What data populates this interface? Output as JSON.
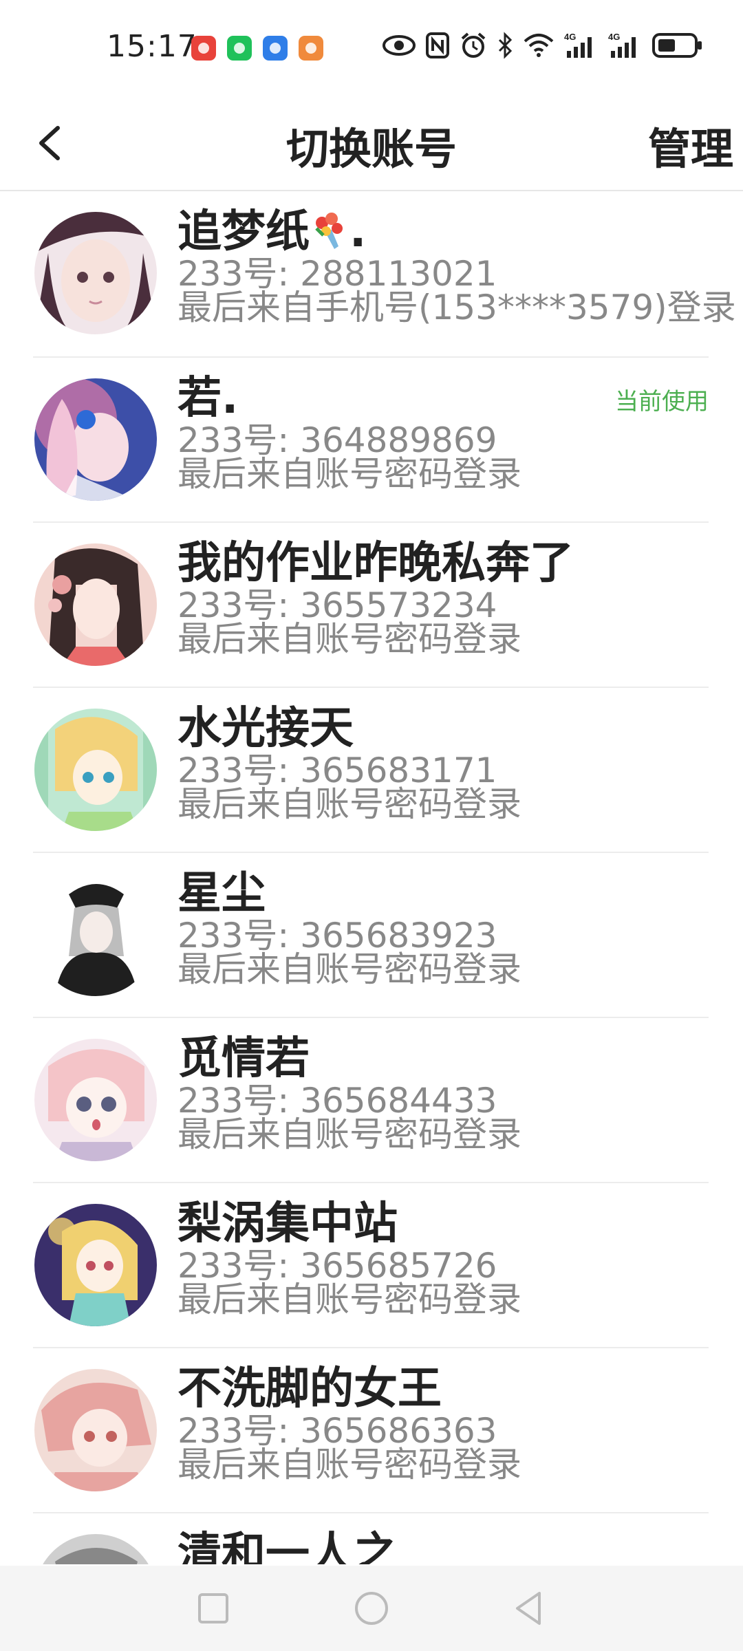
{
  "status_bar": {
    "time": "15:17",
    "icons": [
      "eye-icon",
      "nfc-icon",
      "alarm-icon",
      "bluetooth-icon",
      "wifi-icon",
      "4g-signal-icon",
      "4g-signal-icon",
      "battery-icon"
    ],
    "signal_label_1": "4G",
    "signal_label_2": "4G"
  },
  "header": {
    "title": "切换账号",
    "manage_label": "管理",
    "back_icon": "chevron-left-icon"
  },
  "accounts": [
    {
      "nickname": "追梦纸",
      "nickname_suffix": ".",
      "uid": "233号: 288113021",
      "login": "最后来自手机号(153****3579)登录",
      "colors": [
        "#f1e6ea",
        "#4a2e3c",
        "#c88a9a"
      ]
    },
    {
      "nickname": "若.",
      "uid": "233号: 364889869",
      "login": "最后来自账号密码登录",
      "current_label": "当前使用",
      "colors": [
        "#3d4fa8",
        "#e07aa6",
        "#f2c3d8"
      ]
    },
    {
      "nickname": "我的作业昨晚私奔了",
      "uid": "233号: 365573234",
      "login": "最后来自账号密码登录",
      "colors": [
        "#f3d6d0",
        "#3a2a2a",
        "#e9a0a0"
      ]
    },
    {
      "nickname": "水光接天",
      "uid": "233号: 365683171",
      "login": "最后来自账号密码登录",
      "colors": [
        "#bfe8d2",
        "#f3d27a",
        "#fbe9b0"
      ]
    },
    {
      "nickname": "星尘",
      "uid": "233号: 365683923",
      "login": "最后来自账号密码登录",
      "colors": [
        "#ffffff",
        "#1f1f1f",
        "#bdbdbd"
      ]
    },
    {
      "nickname": "觅情若",
      "uid": "233号: 365684433",
      "login": "最后来自账号密码登录",
      "colors": [
        "#f5e8ee",
        "#f4c4c8",
        "#c9b8d6"
      ]
    },
    {
      "nickname": "梨涡集中站",
      "uid": "233号: 365685726",
      "login": "最后来自账号密码登录",
      "colors": [
        "#3a2f6b",
        "#f0d070",
        "#7fd0c8"
      ]
    },
    {
      "nickname": "不洗脚的女王",
      "uid": "233号: 365686363",
      "login": "最后来自账号密码登录",
      "colors": [
        "#f2dcd6",
        "#e7a4a0",
        "#c2625e"
      ]
    },
    {
      "nickname": "清和一人之",
      "uid": "",
      "login": "",
      "colors": [
        "#cfcfcf",
        "#888888",
        "#e5e5e5"
      ]
    }
  ],
  "nav_bar": {
    "buttons": [
      "square-recents-icon",
      "circle-home-icon",
      "triangle-back-icon"
    ]
  },
  "colors": {
    "current_label": "#4caf50",
    "secondary_text": "#888888",
    "primary_text": "#222222",
    "divider": "#ececec"
  }
}
